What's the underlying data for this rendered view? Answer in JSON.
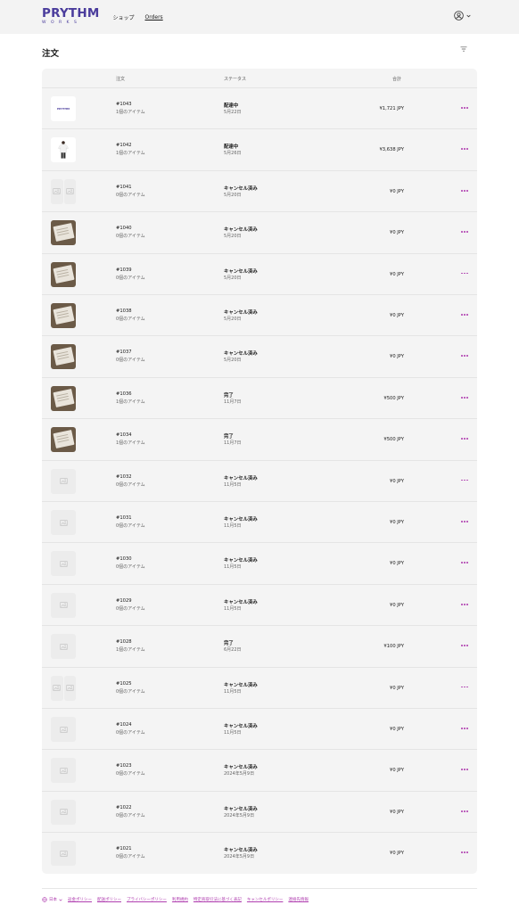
{
  "brand": {
    "top": "PRYTHM",
    "bottom": "WORKS"
  },
  "nav": {
    "shop": "ショップ",
    "orders": "Orders"
  },
  "page": {
    "title": "注文"
  },
  "table": {
    "headers": {
      "order": "注文",
      "status": "ステータス",
      "total": "合計"
    },
    "rows": [
      {
        "thumb": "brand-logo",
        "num": "#1043",
        "count": "1個のアイテム",
        "status": "配達中",
        "date": "5月22日",
        "total": "¥1,721 JPY"
      },
      {
        "thumb": "tshirt",
        "num": "#1042",
        "count": "1個のアイテム",
        "status": "配達中",
        "date": "5月26日",
        "total": "¥3,638 JPY"
      },
      {
        "thumb": "placeholder-double",
        "num": "#1041",
        "count": "0個のアイテム",
        "status": "キャンセル済み",
        "date": "5月20日",
        "total": "¥0 JPY"
      },
      {
        "thumb": "photo",
        "num": "#1040",
        "count": "0個のアイテム",
        "status": "キャンセル済み",
        "date": "5月20日",
        "total": "¥0 JPY"
      },
      {
        "thumb": "photo",
        "num": "#1039",
        "count": "0個のアイテム",
        "status": "キャンセル済み",
        "date": "5月20日",
        "total": "¥0 JPY"
      },
      {
        "thumb": "photo",
        "num": "#1038",
        "count": "0個のアイテム",
        "status": "キャンセル済み",
        "date": "5月20日",
        "total": "¥0 JPY"
      },
      {
        "thumb": "photo",
        "num": "#1037",
        "count": "0個のアイテム",
        "status": "キャンセル済み",
        "date": "5月20日",
        "total": "¥0 JPY"
      },
      {
        "thumb": "photo",
        "num": "#1036",
        "count": "1個のアイテム",
        "status": "完了",
        "date": "11月7日",
        "total": "¥500 JPY"
      },
      {
        "thumb": "photo",
        "num": "#1034",
        "count": "1個のアイテム",
        "status": "完了",
        "date": "11月7日",
        "total": "¥500 JPY"
      },
      {
        "thumb": "placeholder",
        "num": "#1032",
        "count": "0個のアイテム",
        "status": "キャンセル済み",
        "date": "11月5日",
        "total": "¥0 JPY"
      },
      {
        "thumb": "placeholder",
        "num": "#1031",
        "count": "0個のアイテム",
        "status": "キャンセル済み",
        "date": "11月5日",
        "total": "¥0 JPY"
      },
      {
        "thumb": "placeholder",
        "num": "#1030",
        "count": "0個のアイテム",
        "status": "キャンセル済み",
        "date": "11月5日",
        "total": "¥0 JPY"
      },
      {
        "thumb": "placeholder",
        "num": "#1029",
        "count": "0個のアイテム",
        "status": "キャンセル済み",
        "date": "11月5日",
        "total": "¥0 JPY"
      },
      {
        "thumb": "placeholder",
        "num": "#1028",
        "count": "1個のアイテム",
        "status": "完了",
        "date": "6月22日",
        "total": "¥100 JPY"
      },
      {
        "thumb": "placeholder-double",
        "num": "#1025",
        "count": "0個のアイテム",
        "status": "キャンセル済み",
        "date": "11月5日",
        "total": "¥0 JPY"
      },
      {
        "thumb": "placeholder",
        "num": "#1024",
        "count": "0個のアイテム",
        "status": "キャンセル済み",
        "date": "11月5日",
        "total": "¥0 JPY"
      },
      {
        "thumb": "placeholder",
        "num": "#1023",
        "count": "0個のアイテム",
        "status": "キャンセル済み",
        "date": "2024年5月9日",
        "total": "¥0 JPY"
      },
      {
        "thumb": "placeholder",
        "num": "#1022",
        "count": "0個のアイテム",
        "status": "キャンセル済み",
        "date": "2024年5月9日",
        "total": "¥0 JPY"
      },
      {
        "thumb": "placeholder",
        "num": "#1021",
        "count": "0個のアイテム",
        "status": "キャンセル済み",
        "date": "2024年5月9日",
        "total": "¥0 JPY"
      }
    ]
  },
  "footer": {
    "language": "日本",
    "links": [
      "返金ポリシー",
      "配送ポリシー",
      "プライバシーポリシー",
      "利用規約",
      "特定商取引法に基づく表記",
      "キャンセルポリシー",
      "連絡先情報"
    ]
  },
  "colors": {
    "brand": "#4a3c9c",
    "accent": "#b03fb0",
    "header_bg": "#f3f3f3",
    "card_bg": "#f4f4f4"
  }
}
